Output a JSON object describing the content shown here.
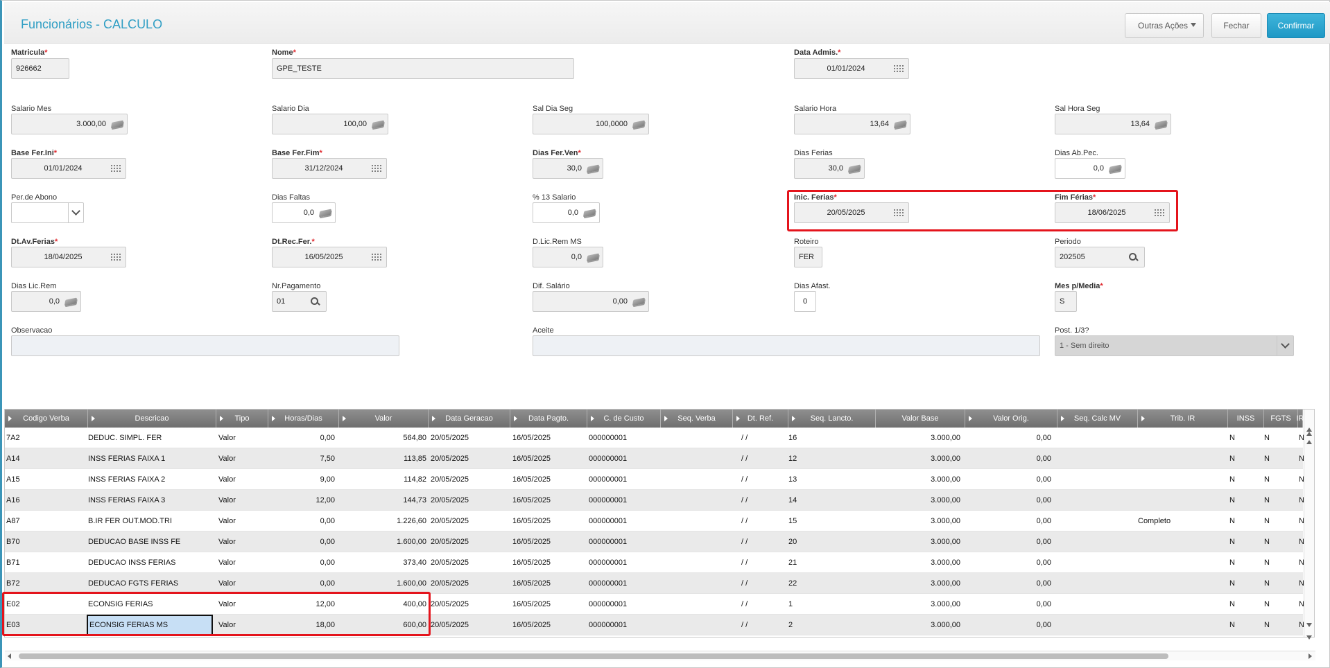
{
  "header": {
    "title": "Funcionários - CALCULO",
    "buttons": {
      "outras": "Outras Ações",
      "fechar": "Fechar",
      "confirmar": "Confirmar"
    }
  },
  "form": {
    "matricula": {
      "label": "Matricula",
      "value": "926662"
    },
    "nome": {
      "label": "Nome",
      "value": "GPE_TESTE"
    },
    "data_admis": {
      "label": "Data Admis.",
      "value": "01/01/2024"
    },
    "salario_mes": {
      "label": "Salario Mes",
      "value": "3.000,00"
    },
    "salario_dia": {
      "label": "Salario Dia",
      "value": "100,00"
    },
    "sal_dia_seg": {
      "label": "Sal Dia Seg",
      "value": "100,0000"
    },
    "salario_hora": {
      "label": "Salario Hora",
      "value": "13,64"
    },
    "sal_hora_seg": {
      "label": "Sal Hora Seg",
      "value": "13,64"
    },
    "base_fer_ini": {
      "label": "Base Fer.Ini",
      "value": "01/01/2024"
    },
    "base_fer_fim": {
      "label": "Base Fer.Fim",
      "value": "31/12/2024"
    },
    "dias_fer_ven": {
      "label": "Dias Fer.Ven",
      "value": "30,0"
    },
    "dias_ferias": {
      "label": "Dias Ferias",
      "value": "30,0"
    },
    "dias_ab_pec": {
      "label": "Dias Ab.Pec.",
      "value": "0,0"
    },
    "per_abono": {
      "label": "Per.de Abono",
      "value": ""
    },
    "dias_faltas": {
      "label": "Dias Faltas",
      "value": "0,0"
    },
    "pct_13_salario": {
      "label": "% 13 Salario",
      "value": "0,0"
    },
    "inic_ferias": {
      "label": "Inic. Ferias",
      "value": "20/05/2025"
    },
    "fim_ferias": {
      "label": "Fim Férias",
      "value": "18/06/2025"
    },
    "dt_av_ferias": {
      "label": "Dt.Av.Ferias",
      "value": "18/04/2025"
    },
    "dt_rec_fer": {
      "label": "Dt.Rec.Fer.",
      "value": "16/05/2025"
    },
    "d_lic_rem_ms": {
      "label": "D.Lic.Rem MS",
      "value": "0,0"
    },
    "roteiro": {
      "label": "Roteiro",
      "value": "FER"
    },
    "periodo": {
      "label": "Periodo",
      "value": "202505"
    },
    "dias_lic_rem": {
      "label": "Dias Lic.Rem",
      "value": "0,0"
    },
    "nr_pagamento": {
      "label": "Nr.Pagamento",
      "value": "01"
    },
    "dif_salario": {
      "label": "Dif. Salário",
      "value": "0,00"
    },
    "dias_afast": {
      "label": "Dias Afast.",
      "value": "0"
    },
    "mes_p_media": {
      "label": "Mes p/Media",
      "value": "S"
    },
    "observacao": {
      "label": "Observacao",
      "value": ""
    },
    "aceite": {
      "label": "Aceite",
      "value": ""
    },
    "post_13": {
      "label": "Post. 1/3?",
      "value": "1 - Sem direito"
    }
  },
  "grid": {
    "columns": [
      "Codigo Verba",
      "Descricao",
      "Tipo",
      "Horas/Dias",
      "Valor",
      "Data Geracao",
      "Data Pagto.",
      "C. de Custo",
      "Seq. Verba",
      "Dt. Ref.",
      "Seq. Lancto.",
      "Valor Base",
      "Valor Orig.",
      "Seq. Calc MV",
      "Trib. IR",
      "INSS",
      "FGTS",
      "IR"
    ],
    "rows": [
      [
        "7A2",
        "DEDUC. SIMPL. FER",
        "Valor",
        "0,00",
        "564,80",
        "20/05/2025",
        "16/05/2025",
        "000000001",
        "",
        "/ /",
        "16",
        "3.000,00",
        "0,00",
        "",
        "",
        "N",
        "N",
        "N"
      ],
      [
        "A14",
        "INSS FERIAS FAIXA 1",
        "Valor",
        "7,50",
        "113,85",
        "20/05/2025",
        "16/05/2025",
        "000000001",
        "",
        "/ /",
        "12",
        "3.000,00",
        "0,00",
        "",
        "",
        "N",
        "N",
        "N"
      ],
      [
        "A15",
        "INSS FERIAS FAIXA 2",
        "Valor",
        "9,00",
        "114,82",
        "20/05/2025",
        "16/05/2025",
        "000000001",
        "",
        "/ /",
        "13",
        "3.000,00",
        "0,00",
        "",
        "",
        "N",
        "N",
        "N"
      ],
      [
        "A16",
        "INSS FERIAS FAIXA 3",
        "Valor",
        "12,00",
        "144,73",
        "20/05/2025",
        "16/05/2025",
        "000000001",
        "",
        "/ /",
        "14",
        "3.000,00",
        "0,00",
        "",
        "",
        "N",
        "N",
        "N"
      ],
      [
        "A87",
        "B.IR FER OUT.MOD.TRI",
        "Valor",
        "0,00",
        "1.226,60",
        "20/05/2025",
        "16/05/2025",
        "000000001",
        "",
        "/ /",
        "15",
        "3.000,00",
        "0,00",
        "",
        "Completo",
        "N",
        "N",
        "N"
      ],
      [
        "B70",
        "DEDUCAO BASE INSS FE",
        "Valor",
        "0,00",
        "1.600,00",
        "20/05/2025",
        "16/05/2025",
        "000000001",
        "",
        "/ /",
        "20",
        "3.000,00",
        "0,00",
        "",
        "",
        "N",
        "N",
        "N"
      ],
      [
        "B71",
        "DEDUCAO INSS FERIAS",
        "Valor",
        "0,00",
        "373,40",
        "20/05/2025",
        "16/05/2025",
        "000000001",
        "",
        "/ /",
        "21",
        "3.000,00",
        "0,00",
        "",
        "",
        "N",
        "N",
        "N"
      ],
      [
        "B72",
        "DEDUCAO FGTS FERIAS",
        "Valor",
        "0,00",
        "1.600,00",
        "20/05/2025",
        "16/05/2025",
        "000000001",
        "",
        "/ /",
        "22",
        "3.000,00",
        "0,00",
        "",
        "",
        "N",
        "N",
        "N"
      ],
      [
        "E02",
        "ECONSIG FERIAS",
        "Valor",
        "12,00",
        "400,00",
        "20/05/2025",
        "16/05/2025",
        "000000001",
        "",
        "/ /",
        "1",
        "3.000,00",
        "0,00",
        "",
        "",
        "N",
        "N",
        "N"
      ],
      [
        "E03",
        "ECONSIG FERIAS MS",
        "Valor",
        "18,00",
        "600,00",
        "20/05/2025",
        "16/05/2025",
        "000000001",
        "",
        "/ /",
        "2",
        "3.000,00",
        "0,00",
        "",
        "",
        "N",
        "N",
        "N"
      ]
    ]
  },
  "colors": {
    "accent": "#2f9ec4",
    "confirm": "#1f98c5",
    "required": "#e0282e",
    "highlight": "#e4141c"
  }
}
